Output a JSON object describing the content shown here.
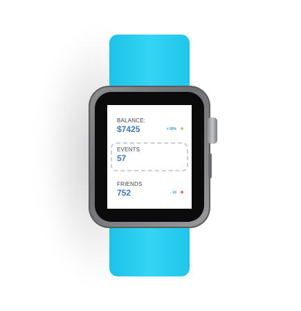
{
  "stats": [
    {
      "label": "BALANCE:",
      "value": "$7425",
      "delta": "+ 50%",
      "trend_icon": "plus-icon",
      "trend_color": "#8bc34a"
    },
    {
      "label": "EVENTS",
      "value": "57"
    },
    {
      "label": "FRIENDS",
      "value": "752",
      "delta": "- 10",
      "trend_icon": "plus-icon",
      "trend_color": "#e53935"
    }
  ],
  "colors": {
    "band": "#28cdf0",
    "value": "#3d78b8",
    "label": "#3b4350"
  }
}
